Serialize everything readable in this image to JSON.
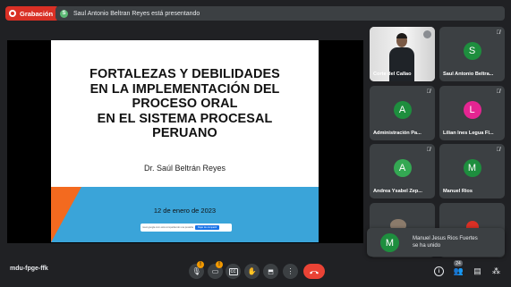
{
  "recording": {
    "label": "Grabación"
  },
  "presenting_bar": {
    "avatar_letter": "S",
    "text": "Saul Antonio Beltran Reyes está presentando"
  },
  "slide": {
    "title": "FORTALEZAS Y DEBILIDADES\nEN LA IMPLEMENTACIÓN DEL\nPROCESO ORAL\nEN EL SISTEMA PROCESAL\nPERUANO",
    "author": "Dr. Saúl Beltrán Reyes",
    "date": "12 de enero de 2023",
    "share_notice": {
      "text": "meet.google.com está compartiendo una pestaña",
      "button": "Dejar de compartir"
    }
  },
  "participants": [
    {
      "name": "Corte del Callao",
      "type": "video"
    },
    {
      "name": "Saul Antonio Beltra...",
      "letter": "S",
      "color": "#1e8e3e",
      "muted": true
    },
    {
      "name": "Administración Pa...",
      "letter": "A",
      "color": "#1e8e3e",
      "muted": true
    },
    {
      "name": "Lilian Ines Legua Fl...",
      "letter": "L",
      "color": "#e52592",
      "muted": true
    },
    {
      "name": "Andrea Ysabel Zep...",
      "letter": "A",
      "color": "#34a853",
      "muted": true
    },
    {
      "name": "Manuel Rios",
      "letter": "M",
      "color": "#1e8e3e",
      "muted": true
    }
  ],
  "toast": {
    "letter": "M",
    "message": "Manuel Jesus Rios Fuertes\nse ha unido"
  },
  "bottom": {
    "meeting_code": "mdu-fpge-ffk",
    "participant_count": "24"
  },
  "icons": [
    "record-icon",
    "mic-off-icon",
    "camera-off-icon",
    "captions-icon",
    "raise-hand-icon",
    "present-icon",
    "more-options-icon",
    "end-call-icon",
    "info-icon",
    "people-icon",
    "chat-icon",
    "activities-icon"
  ]
}
